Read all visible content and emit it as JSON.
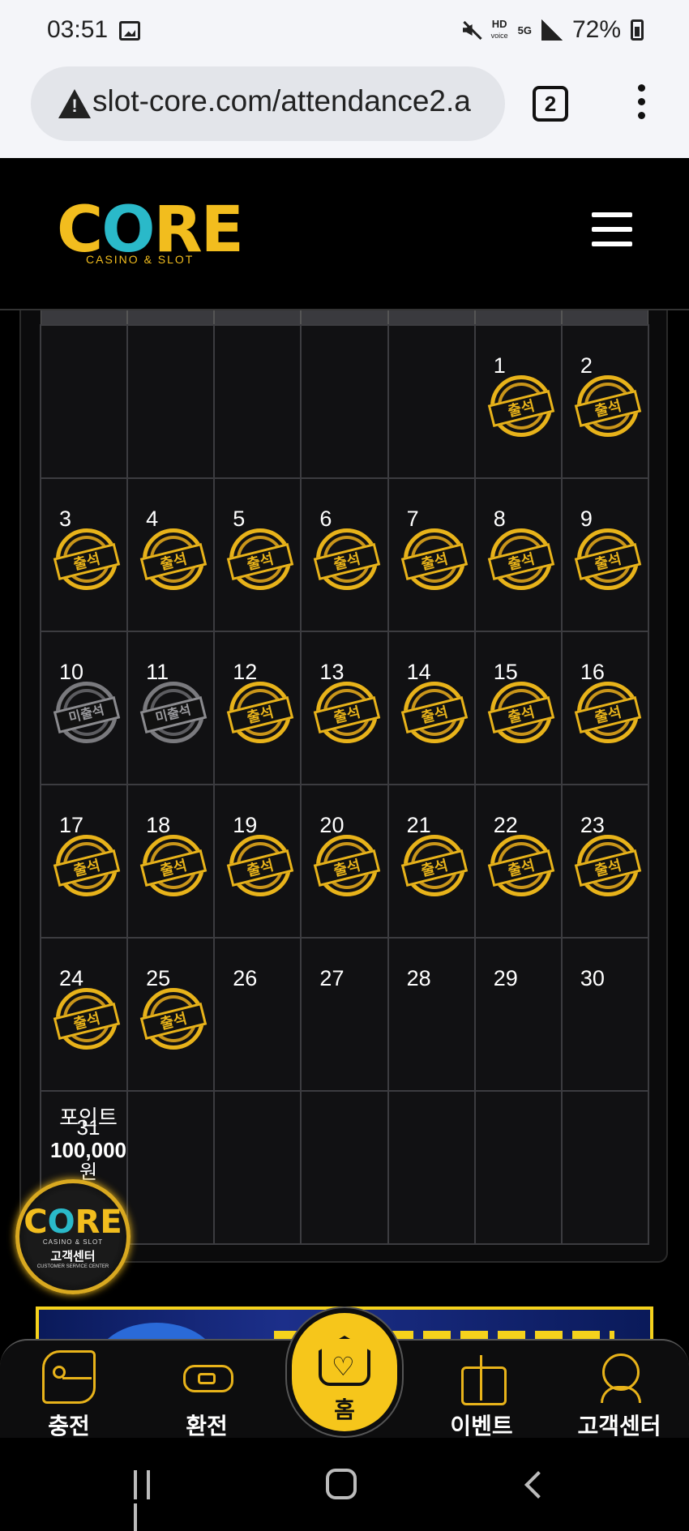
{
  "status_bar": {
    "time": "03:51",
    "hd_label": "HD",
    "voice_label": "voice",
    "network": "5G",
    "battery": "72%",
    "icons": [
      "photo-icon",
      "mute-icon",
      "signal-icon",
      "battery-icon"
    ]
  },
  "browser": {
    "url": "slot-core.com/attendance2.a",
    "tab_count": "2",
    "icons": [
      "warning-icon",
      "kebab-menu-icon"
    ]
  },
  "site": {
    "logo_letters": [
      "C",
      "O",
      "RE"
    ],
    "logo_sub": "CASINO & SLOT",
    "colors": {
      "gold": "#f2bd1e",
      "teal": "#2ab9c9"
    }
  },
  "calendar": {
    "attended_label": "출석",
    "missed_label": "미출석",
    "rows": [
      [
        {
          "day": "",
          "status": "none"
        },
        {
          "day": "",
          "status": "none"
        },
        {
          "day": "",
          "status": "none"
        },
        {
          "day": "",
          "status": "none"
        },
        {
          "day": "",
          "status": "none"
        },
        {
          "day": "1",
          "status": "attended"
        },
        {
          "day": "2",
          "status": "attended"
        }
      ],
      [
        {
          "day": "3",
          "status": "attended"
        },
        {
          "day": "4",
          "status": "attended"
        },
        {
          "day": "5",
          "status": "attended"
        },
        {
          "day": "6",
          "status": "attended"
        },
        {
          "day": "7",
          "status": "attended"
        },
        {
          "day": "8",
          "status": "attended"
        },
        {
          "day": "9",
          "status": "attended"
        }
      ],
      [
        {
          "day": "10",
          "status": "missed"
        },
        {
          "day": "11",
          "status": "missed"
        },
        {
          "day": "12",
          "status": "attended"
        },
        {
          "day": "13",
          "status": "attended"
        },
        {
          "day": "14",
          "status": "attended"
        },
        {
          "day": "15",
          "status": "attended"
        },
        {
          "day": "16",
          "status": "attended"
        }
      ],
      [
        {
          "day": "17",
          "status": "attended"
        },
        {
          "day": "18",
          "status": "attended"
        },
        {
          "day": "19",
          "status": "attended"
        },
        {
          "day": "20",
          "status": "attended"
        },
        {
          "day": "21",
          "status": "attended"
        },
        {
          "day": "22",
          "status": "attended"
        },
        {
          "day": "23",
          "status": "attended"
        }
      ],
      [
        {
          "day": "24",
          "status": "attended"
        },
        {
          "day": "25",
          "status": "attended"
        },
        {
          "day": "26",
          "status": "none"
        },
        {
          "day": "27",
          "status": "none"
        },
        {
          "day": "28",
          "status": "none"
        },
        {
          "day": "29",
          "status": "none"
        },
        {
          "day": "30",
          "status": "none"
        }
      ]
    ],
    "last_cell": {
      "point_label": "포인트",
      "day": "31",
      "point_value": "100,000",
      "unit": "원"
    }
  },
  "cs_badge": {
    "letters": [
      "C",
      "O",
      "RE"
    ],
    "sub": "CASINO & SLOT",
    "label": "고객센터",
    "en": "CUSTOMER SERVICE CENTER"
  },
  "bottom_nav": {
    "charge": "충전",
    "exchange": "환전",
    "home": "홈",
    "event": "이벤트",
    "support": "고객센터"
  },
  "android_nav": {
    "icons": [
      "recent-apps-icon",
      "home-icon",
      "back-icon"
    ]
  }
}
